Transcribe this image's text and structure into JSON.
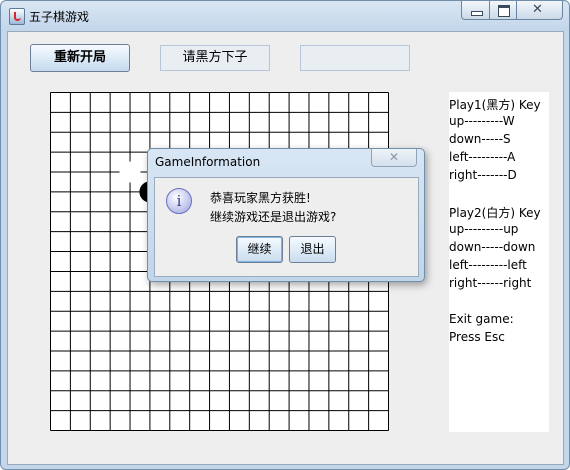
{
  "window": {
    "title": "五子棋游戏",
    "icon": "java-app-icon"
  },
  "toolbar": {
    "restart_label": "重新开局",
    "status_text": "请黑方下子",
    "empty_text": ""
  },
  "board": {
    "grid_lines": 18,
    "stones": [
      {
        "color": "white",
        "col": 4,
        "row": 4
      },
      {
        "color": "black",
        "col": 5,
        "row": 5
      },
      {
        "color": "black",
        "col": 9,
        "row": 9
      }
    ]
  },
  "keys": {
    "lines": [
      "Play1(黑方) Key",
      "up---------W",
      "down-----S",
      "left---------A",
      "right-------D",
      "",
      "Play2(白方) Key",
      "up---------up",
      "down-----down",
      "left---------left",
      "right------right",
      "",
      "Exit game:",
      "Press Esc"
    ]
  },
  "dialog": {
    "title": "GameInformation",
    "close_glyph": "✕",
    "icon": "info-icon",
    "message_line1": "恭喜玩家黑方获胜!",
    "message_line2": "继续游戏还是退出游戏?",
    "continue_label": "继续",
    "quit_label": "退出"
  }
}
